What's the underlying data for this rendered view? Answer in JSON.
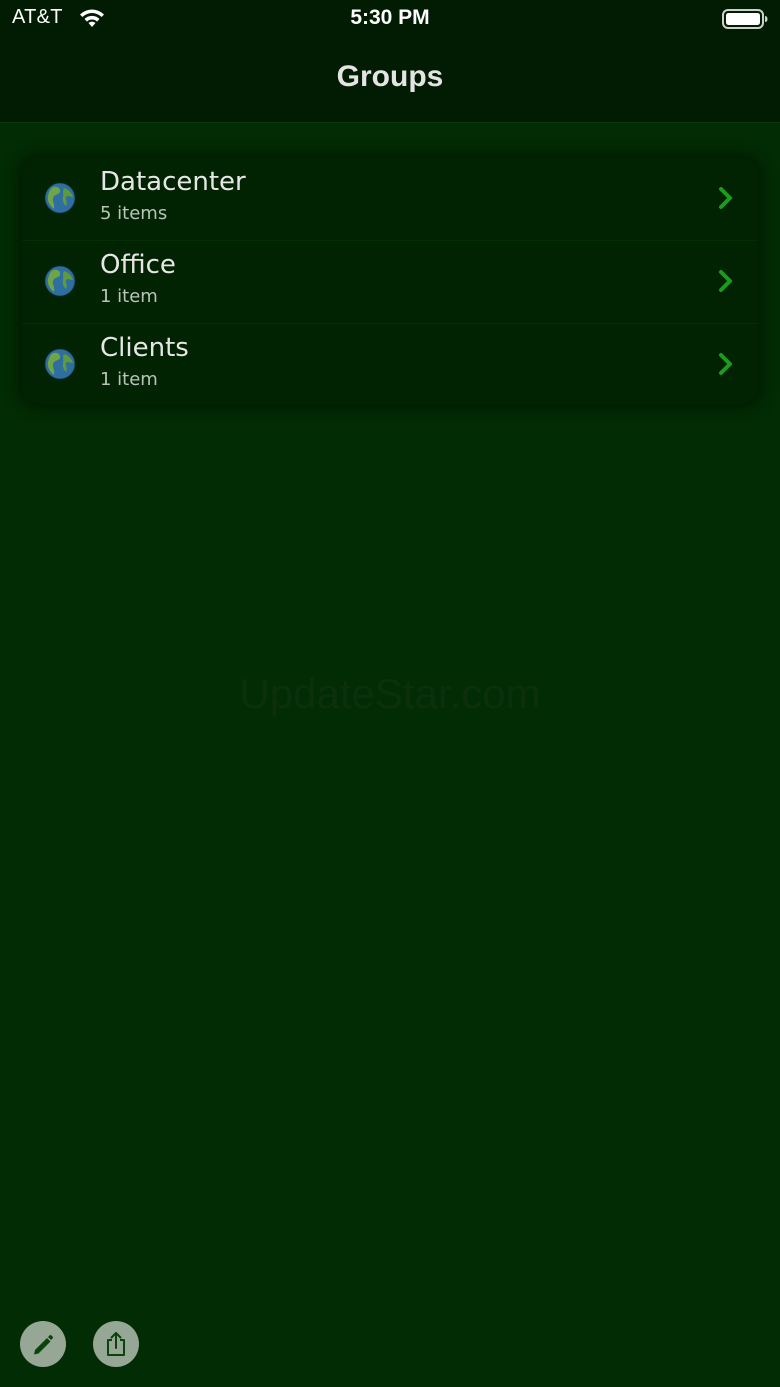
{
  "status_bar": {
    "carrier": "AT&T",
    "time": "5:30 PM"
  },
  "nav": {
    "title": "Groups"
  },
  "groups": [
    {
      "name": "Datacenter",
      "count": "5 items"
    },
    {
      "name": "Office",
      "count": "1 item"
    },
    {
      "name": "Clients",
      "count": "1 item"
    }
  ],
  "watermark": "UpdateStar.com",
  "icons": {
    "row_icon": "globe-icon",
    "row_accessory": "chevron-right-icon",
    "toolbar_left": "pencil-icon",
    "toolbar_right": "share-icon"
  },
  "colors": {
    "background": "#022c03",
    "bar": "#011c02",
    "accent": "#1e9a1e"
  }
}
